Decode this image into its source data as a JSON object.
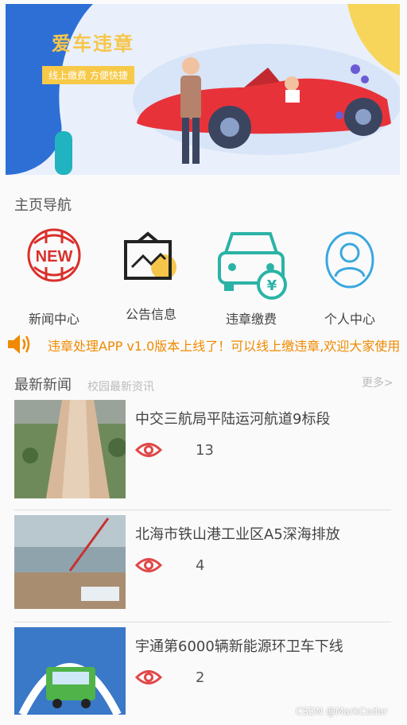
{
  "banner": {
    "title": "爱车违章",
    "subtitle": "线上缴费  方便快捷"
  },
  "nav": {
    "title": "主页导航",
    "items": [
      {
        "label": "新闻中心",
        "icon": "news-icon"
      },
      {
        "label": "公告信息",
        "icon": "announcement-icon"
      },
      {
        "label": "违章缴费",
        "icon": "violation-payment-icon"
      },
      {
        "label": "个人中心",
        "icon": "user-profile-icon"
      }
    ]
  },
  "marquee": {
    "icon": "speaker-icon",
    "text": "违章处理APP v1.0版本上线了！可以线上缴违章,欢迎大家使用"
  },
  "news": {
    "title": "最新新闻",
    "subtitle": "校园最新资讯",
    "more": "更多>",
    "items": [
      {
        "headline": "中交三航局平陆运河航道9标段",
        "views": "13"
      },
      {
        "headline": "北海市铁山港工业区A5深海排放",
        "views": "4"
      },
      {
        "headline": "宇通第6000辆新能源环卫车下线",
        "views": "2"
      }
    ]
  },
  "watermark": "CSDN @MarkCoder",
  "colors": {
    "accent_orange": "#f08a00",
    "news_red": "#d9302b",
    "teal": "#2bb3a6",
    "blue": "#3aa7e0",
    "eye_red": "#e04848"
  }
}
